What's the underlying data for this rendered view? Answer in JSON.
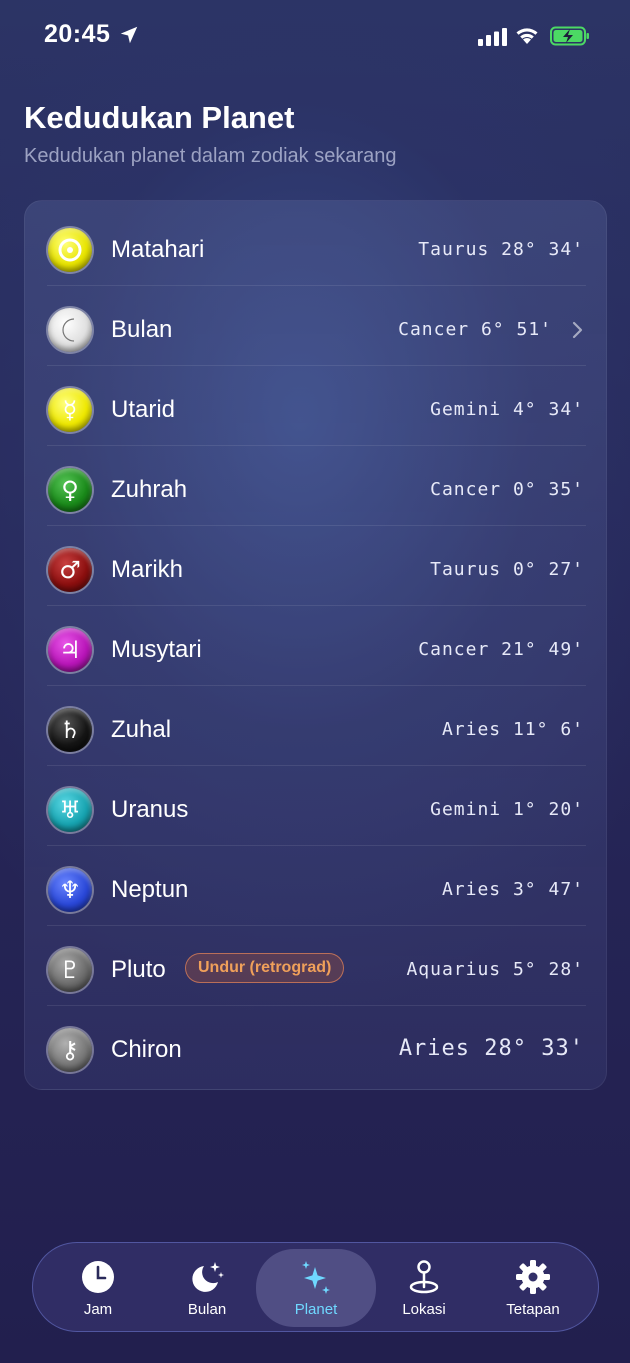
{
  "status_bar": {
    "time": "20:45"
  },
  "header": {
    "title": "Kedudukan Planet",
    "subtitle": "Kedudukan planet dalam zodiak sekarang"
  },
  "planets": [
    {
      "name": "Matahari",
      "position": "Taurus 28° 34'",
      "icon": "sun-icon",
      "color": "#e8e400",
      "glyph": "☉"
    },
    {
      "name": "Bulan",
      "position": "Cancer 6° 51'",
      "icon": "moon-icon",
      "color": "#e6e6e6",
      "glyph": "☾"
    },
    {
      "name": "Utarid",
      "position": "Gemini 4° 34'",
      "icon": "mercury-icon",
      "color": "#eee800",
      "glyph": "☿"
    },
    {
      "name": "Zuhrah",
      "position": "Cancer 0° 35'",
      "icon": "venus-icon",
      "color": "#1a8a1a",
      "glyph": "♀"
    },
    {
      "name": "Marikh",
      "position": "Taurus 0° 27'",
      "icon": "mars-icon",
      "color": "#8c0f0f",
      "glyph": "♂"
    },
    {
      "name": "Musytari",
      "position": "Cancer 21° 49'",
      "icon": "jupiter-icon",
      "color": "#b815b8",
      "glyph": "♃"
    },
    {
      "name": "Zuhal",
      "position": "Aries 11° 6'",
      "icon": "saturn-icon",
      "color": "#151515",
      "glyph": "♄"
    },
    {
      "name": "Uranus",
      "position": "Gemini 1° 20'",
      "icon": "uranus-icon",
      "color": "#17a3b0",
      "glyph": "♅"
    },
    {
      "name": "Neptun",
      "position": "Aries 3° 47'",
      "icon": "neptune-icon",
      "color": "#2a48d8",
      "glyph": "♆"
    },
    {
      "name": "Pluto",
      "position": "Aquarius 5° 28'",
      "icon": "pluto-icon",
      "color": "#6b6b6b",
      "glyph": "♇",
      "badge": "Undur (retrograd)"
    },
    {
      "name": "Chiron",
      "position": "Aries 28° 33'",
      "icon": "chiron-icon",
      "color": "#777777",
      "glyph": "⚷"
    }
  ],
  "tab_bar": {
    "tabs": [
      {
        "label": "Jam",
        "icon": "clock-icon"
      },
      {
        "label": "Bulan",
        "icon": "moon-stars-icon"
      },
      {
        "label": "Planet",
        "icon": "sparkles-icon",
        "active": true
      },
      {
        "label": "Lokasi",
        "icon": "map-pin-icon"
      },
      {
        "label": "Tetapan",
        "icon": "gear-icon"
      }
    ]
  },
  "colors": {
    "accent": "#6fd8ff",
    "retrograde_badge": "#f0a05a",
    "battery_charging": "#4cd964"
  }
}
